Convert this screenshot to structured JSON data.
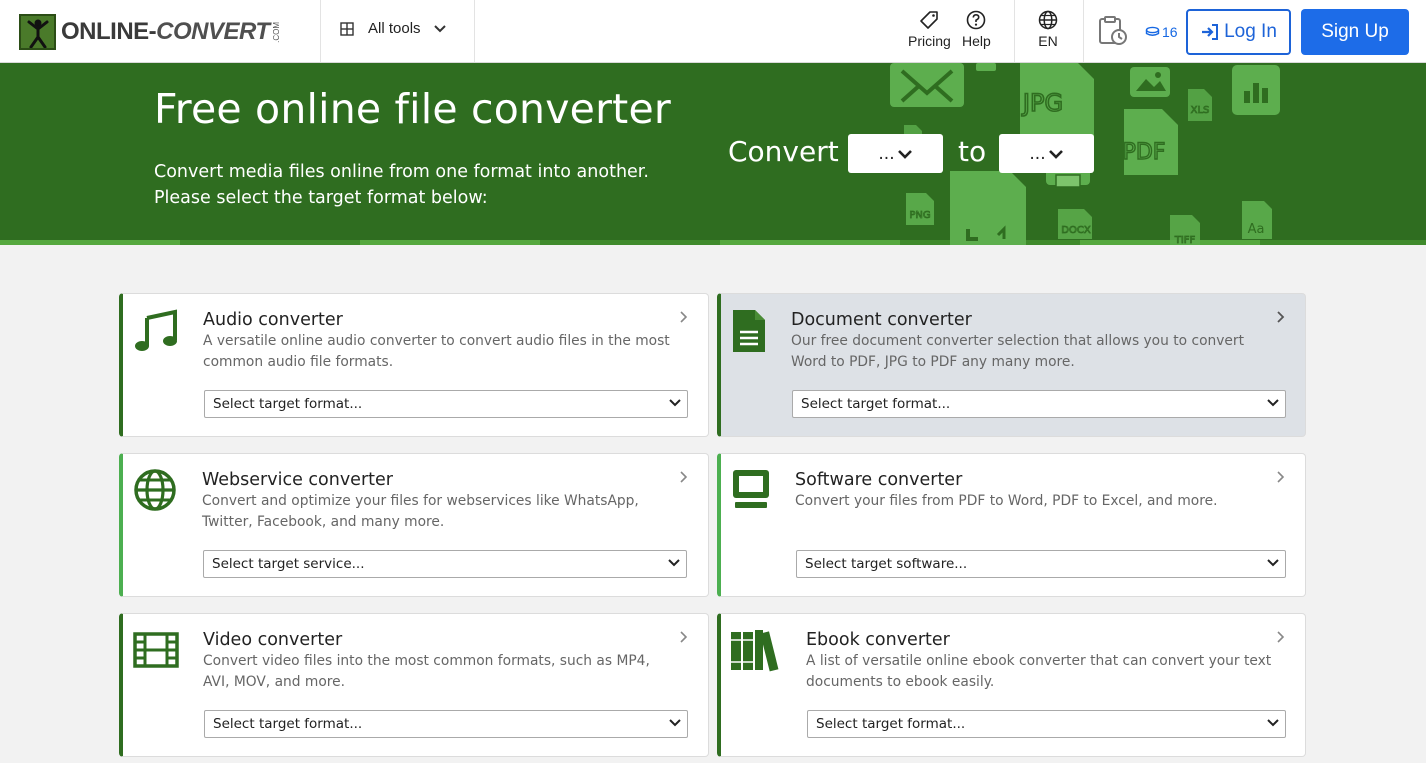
{
  "header": {
    "logo_main": "ONLINE-",
    "logo_convert": "CONVERT",
    "logo_com": ".COM",
    "all_tools": "All tools",
    "pricing": "Pricing",
    "help": "Help",
    "language": "EN",
    "credits": "16",
    "login": "Log In",
    "signup": "Sign Up"
  },
  "hero": {
    "title": "Free online file converter",
    "subtitle": "Convert media files online from one format into another. Please select the target format below:",
    "convert_label": "Convert",
    "to_label": "to",
    "from_value": "...",
    "to_value": "...",
    "art_labels": [
      "JPG",
      "PDF",
      "XLS",
      "PNG",
      "DOCX",
      "TIFF",
      "Aa"
    ]
  },
  "colors": {
    "brand_green": "#2f6d20",
    "accent_blue": "#1d6ce8",
    "card_highlight": "#dde1e6"
  },
  "cards": [
    {
      "title": "Audio converter",
      "icon": "music-note-icon",
      "description": "A versatile online audio converter to convert audio files in the most common audio file formats.",
      "select": "Select target format..."
    },
    {
      "title": "Document converter",
      "icon": "document-icon",
      "description": "Our free document converter selection that allows you to convert Word to PDF, JPG to PDF any many more.",
      "select": "Select target format..."
    },
    {
      "title": "Webservice converter",
      "icon": "globe-icon",
      "description": "Convert and optimize your files for webservices like WhatsApp, Twitter, Facebook, and many more.",
      "select": "Select target service..."
    },
    {
      "title": "Software converter",
      "icon": "monitor-icon",
      "description": "Convert your files from PDF to Word, PDF to Excel, and more.",
      "select": "Select target software..."
    },
    {
      "title": "Video converter",
      "icon": "film-icon",
      "description": "Convert video files into the most common formats, such as MP4, AVI, MOV, and more.",
      "select": "Select target format..."
    },
    {
      "title": "Ebook converter",
      "icon": "books-icon",
      "description": "A list of versatile online ebook converter that can convert your text documents to ebook easily.",
      "select": "Select target format..."
    }
  ]
}
